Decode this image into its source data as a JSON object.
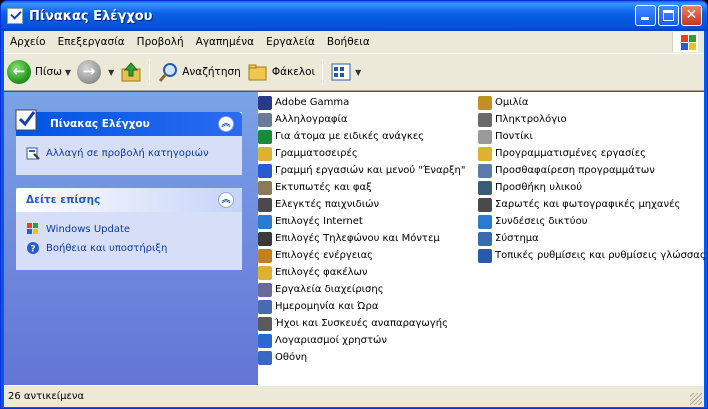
{
  "window": {
    "title": "Πίνακας Ελέγχου"
  },
  "menu": [
    "Αρχείο",
    "Επεξεργασία",
    "Προβολή",
    "Αγαπημένα",
    "Εργαλεία",
    "Βοήθεια"
  ],
  "toolbar": {
    "back": "Πίσω",
    "search": "Αναζήτηση",
    "folders": "Φάκελοι"
  },
  "sidebar": {
    "panel1": {
      "title": "Πίνακας Ελέγχου",
      "link": "Αλλαγή σε προβολή κατηγοριών"
    },
    "panel2": {
      "title": "Δείτε επίσης",
      "links": [
        "Windows Update",
        "Βοήθεια και υποστήριξη"
      ]
    }
  },
  "items_col1": [
    {
      "label": "Adobe Gamma",
      "color": "#2a3a8a"
    },
    {
      "label": "Αλληλογραφία",
      "color": "#6a7a9a"
    },
    {
      "label": "Για άτομα με ειδικές ανάγκες",
      "color": "#1a8a3a"
    },
    {
      "label": "Γραμματοσειρές",
      "color": "#e0b030"
    },
    {
      "label": "Γραμμή εργασιών και μενού \"Έναρξη\"",
      "color": "#2a5ad0"
    },
    {
      "label": "Εκτυπωτές και φαξ",
      "color": "#8a7a5a"
    },
    {
      "label": "Ελεγκτές παιχνιδιών",
      "color": "#4a4a4a"
    },
    {
      "label": "Επιλογές Internet",
      "color": "#2a7ad0"
    },
    {
      "label": "Επιλογές Τηλεφώνου και Μόντεμ",
      "color": "#3a3a3a"
    },
    {
      "label": "Επιλογές ενέργειας",
      "color": "#c08020"
    },
    {
      "label": "Επιλογές φακέλων",
      "color": "#e0b030"
    },
    {
      "label": "Εργαλεία διαχείρισης",
      "color": "#6a6a9a"
    },
    {
      "label": "Ημερομηνία και Ώρα",
      "color": "#4a6ab0"
    },
    {
      "label": "Ήχοι και Συσκευές αναπαραγωγής",
      "color": "#5a5a5a"
    },
    {
      "label": "Λογαριασμοί χρηστών",
      "color": "#2a6ad0"
    },
    {
      "label": "Οθόνη",
      "color": "#3a6ac0"
    }
  ],
  "items_col2": [
    {
      "label": "Ομιλία",
      "color": "#c09020"
    },
    {
      "label": "Πληκτρολόγιο",
      "color": "#6a6a6a"
    },
    {
      "label": "Ποντίκι",
      "color": "#9a9a9a"
    },
    {
      "label": "Προγραμματισμένες εργασίες",
      "color": "#e0b030"
    },
    {
      "label": "Προσθαφαίρεση προγραμμάτων",
      "color": "#5a7ab0"
    },
    {
      "label": "Προσθήκη υλικού",
      "color": "#3a5a7a"
    },
    {
      "label": "Σαρωτές και φωτογραφικές μηχανές",
      "color": "#4a4a4a"
    },
    {
      "label": "Συνδέσεις δικτύου",
      "color": "#2a7ad0"
    },
    {
      "label": "Σύστημα",
      "color": "#3a6ab0"
    },
    {
      "label": "Τοπικές ρυθμίσεις και ρυθμίσεις γλώσσας",
      "color": "#2a5ab0"
    }
  ],
  "status": {
    "text": "26 αντικείμενα"
  }
}
